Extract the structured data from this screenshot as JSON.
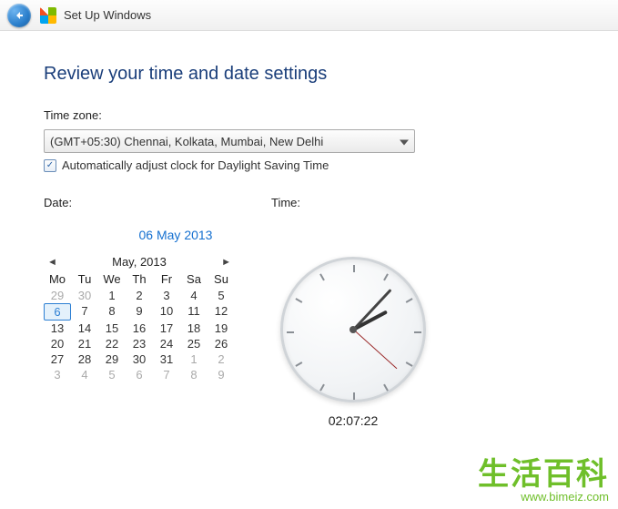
{
  "titlebar": {
    "title": "Set Up Windows"
  },
  "heading": "Review your time and date settings",
  "timezone": {
    "label": "Time zone:",
    "selected": "(GMT+05:30) Chennai, Kolkata, Mumbai, New Delhi"
  },
  "dst": {
    "checked": true,
    "label": "Automatically adjust clock for Daylight Saving Time"
  },
  "date": {
    "label": "Date:",
    "selected_display": "06 May 2013",
    "month_label": "May, 2013",
    "weekdays": [
      "Mo",
      "Tu",
      "We",
      "Th",
      "Fr",
      "Sa",
      "Su"
    ],
    "grid": [
      {
        "n": 29,
        "out": true
      },
      {
        "n": 30,
        "out": true
      },
      {
        "n": 1
      },
      {
        "n": 2
      },
      {
        "n": 3
      },
      {
        "n": 4
      },
      {
        "n": 5
      },
      {
        "n": 6,
        "sel": true
      },
      {
        "n": 7
      },
      {
        "n": 8
      },
      {
        "n": 9
      },
      {
        "n": 10
      },
      {
        "n": 11
      },
      {
        "n": 12
      },
      {
        "n": 13
      },
      {
        "n": 14
      },
      {
        "n": 15
      },
      {
        "n": 16
      },
      {
        "n": 17
      },
      {
        "n": 18
      },
      {
        "n": 19
      },
      {
        "n": 20
      },
      {
        "n": 21
      },
      {
        "n": 22
      },
      {
        "n": 23
      },
      {
        "n": 24
      },
      {
        "n": 25
      },
      {
        "n": 26
      },
      {
        "n": 27
      },
      {
        "n": 28
      },
      {
        "n": 29
      },
      {
        "n": 30
      },
      {
        "n": 31
      },
      {
        "n": 1,
        "out": true
      },
      {
        "n": 2,
        "out": true
      },
      {
        "n": 3,
        "out": true
      },
      {
        "n": 4,
        "out": true
      },
      {
        "n": 5,
        "out": true
      },
      {
        "n": 6,
        "out": true
      },
      {
        "n": 7,
        "out": true
      },
      {
        "n": 8,
        "out": true
      },
      {
        "n": 9,
        "out": true
      }
    ]
  },
  "time": {
    "label": "Time:",
    "display": "02:07:22"
  },
  "watermark": {
    "cn": "生活百科",
    "url": "www.bimeiz.com"
  }
}
